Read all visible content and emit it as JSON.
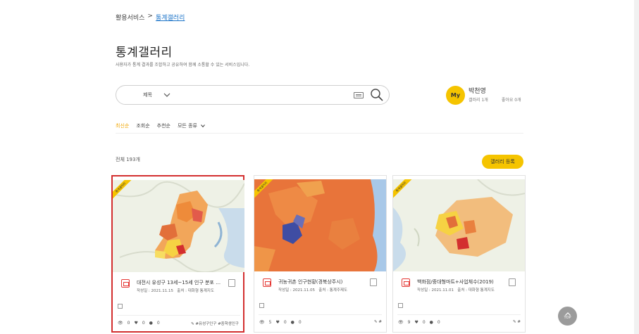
{
  "breadcrumb": {
    "root": "활용서비스",
    "sep": ">",
    "current": "통계갤러리"
  },
  "page": {
    "title": "통계갤러리",
    "description": "사용자가 통계 결과를 조합하고 공유하여 함께 소통할 수 있는 서비스입니다."
  },
  "search": {
    "select_label": "제목",
    "select_icon": "chevron-down-icon"
  },
  "profile": {
    "avatar_text": "My",
    "name": "박천영",
    "gallery": "갤러리 1개",
    "likes": "좋아요 0개"
  },
  "sort": {
    "latest": "최신순",
    "views": "조회순",
    "recommend": "추천순",
    "all_types": "모든 종류"
  },
  "total": "전체 193개",
  "register_button": "갤러리 등록",
  "ribbon": "통계갤러리",
  "cards": [
    {
      "title": "대전시 유성구 13세~15세 인구 분포 …",
      "date": "작성일 : 2021.11.15",
      "source": "출처 : 대화형 통계지도",
      "views": "0",
      "likes": "0",
      "comments": "0",
      "tags": "#유성구인구 #중학생인구"
    },
    {
      "title": "귀농귀촌 인구현황(경북상주시)",
      "date": "작성일 : 2021.11.05",
      "source": "출처 : 통계주제도",
      "views": "5",
      "likes": "0",
      "comments": "0",
      "tags": "#"
    },
    {
      "title": "백화점/중대형마트+사업체수(2019)",
      "date": "작성일 : 2021.11.01",
      "source": "출처 : 대화형 통계지도",
      "views": "9",
      "likes": "0",
      "comments": "0",
      "tags": "#"
    }
  ],
  "top_button": "TOP",
  "colors": {
    "accent": "#f5c400",
    "link": "#1a73c8",
    "selected": "#d32f2f"
  }
}
